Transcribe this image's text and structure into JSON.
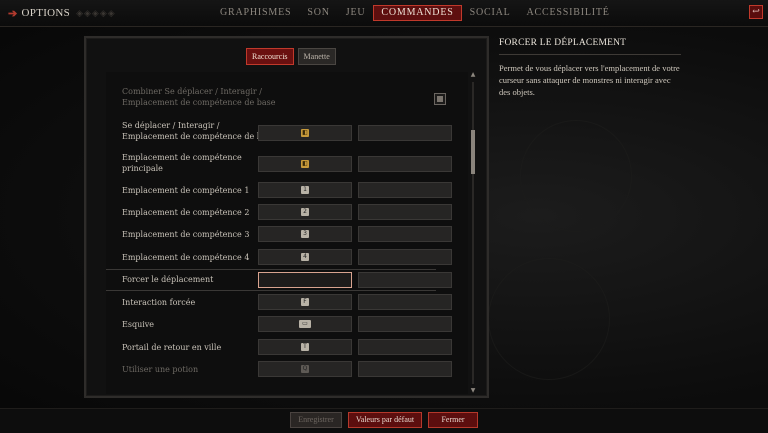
{
  "topbar": {
    "title": "OPTIONS",
    "tabs": [
      "GRAPHISMES",
      "SON",
      "JEU",
      "COMMANDES",
      "SOCIAL",
      "ACCESSIBILITÉ"
    ],
    "active_tab": "COMMANDES"
  },
  "subtabs": [
    "Raccourcis",
    "Manette"
  ],
  "active_subtab": "Raccourcis",
  "bindings": [
    {
      "label_lines": [
        "Combiner Se déplacer / Interagir /",
        "Emplacement de compétence de base"
      ],
      "type": "checkbox",
      "dim": true
    },
    {
      "label_lines": [
        "Se déplacer / Interagir /",
        "Emplacement de compétence de base"
      ],
      "primary": "mouse-left"
    },
    {
      "label_lines": [
        "Emplacement de compétence",
        "principale"
      ],
      "primary": "mouse-right"
    },
    {
      "label_lines": [
        "Emplacement de compétence 1"
      ],
      "primary": "1"
    },
    {
      "label_lines": [
        "Emplacement de compétence 2"
      ],
      "primary": "2"
    },
    {
      "label_lines": [
        "Emplacement de compétence 3"
      ],
      "primary": "3"
    },
    {
      "label_lines": [
        "Emplacement de compétence 4"
      ],
      "primary": "4"
    },
    {
      "label_lines": [
        "Forcer le déplacement"
      ],
      "primary": "",
      "selected": true
    },
    {
      "label_lines": [
        "Interaction forcée"
      ],
      "primary": "F"
    },
    {
      "label_lines": [
        "Esquive"
      ],
      "primary": "space"
    },
    {
      "label_lines": [
        "Portail de retour en ville"
      ],
      "primary": "T"
    },
    {
      "label_lines": [
        "Utiliser une potion"
      ],
      "primary": "Q",
      "dim": true
    }
  ],
  "info": {
    "title": "FORCER LE DÉPLACEMENT",
    "body": "Permet de vous déplacer vers l'emplacement de votre curseur sans attaquer de monstres ni interagir avec des objets."
  },
  "footer": {
    "save": "Enregistrer",
    "defaults": "Valeurs par défaut",
    "close": "Fermer"
  },
  "colors": {
    "accent": "#c0392b",
    "active_fill": "#5e0f0f"
  }
}
